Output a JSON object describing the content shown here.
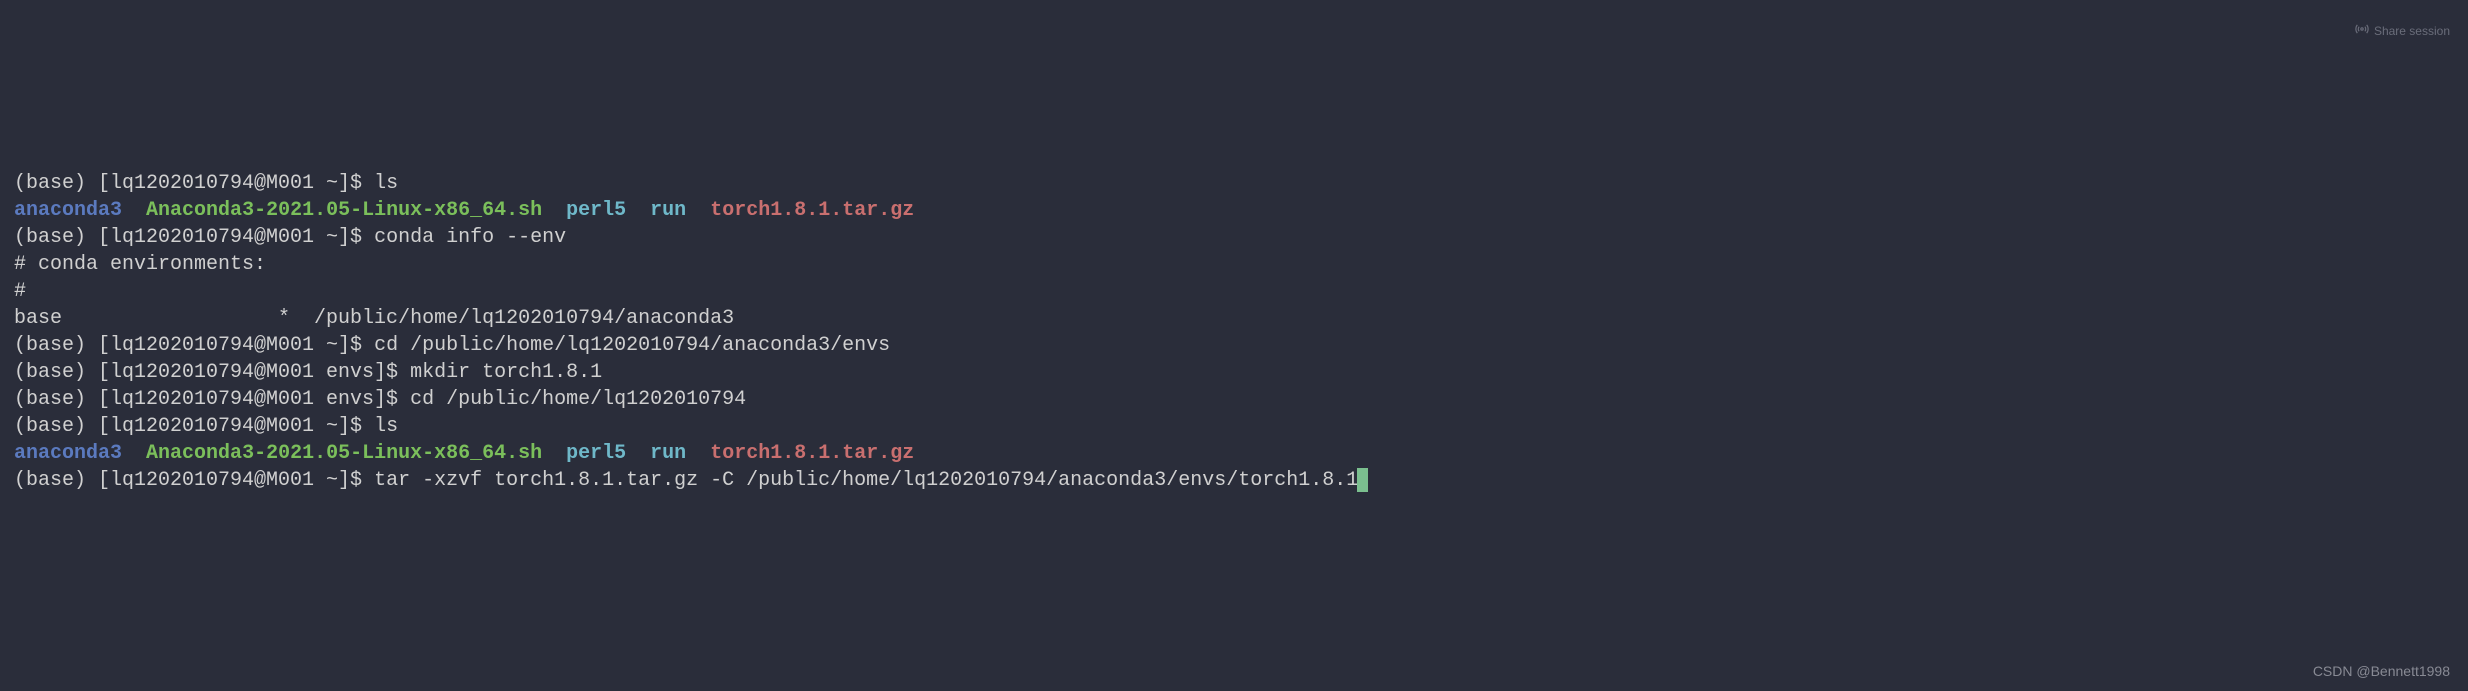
{
  "share": {
    "label": "Share session"
  },
  "watermark": "CSDN @Bennett1998",
  "lines": {
    "l1": {
      "prompt": "(base) [lq1202010794@M001 ~]$ ",
      "cmd": "ls"
    },
    "ls_out1": {
      "anaconda3": "anaconda3",
      "installer": "Anaconda3-2021.05-Linux-x86_64.sh",
      "perl5": "perl5",
      "run": "run",
      "tarball": "torch1.8.1.tar.gz"
    },
    "l3": {
      "prompt": "(base) [lq1202010794@M001 ~]$ ",
      "cmd": "conda info --env"
    },
    "l4": "# conda environments:",
    "l5": "#",
    "l6": "base                  *  /public/home/lq1202010794/anaconda3",
    "l7": "",
    "l8": {
      "prompt": "(base) [lq1202010794@M001 ~]$ ",
      "cmd": "cd /public/home/lq1202010794/anaconda3/envs"
    },
    "l9": {
      "prompt": "(base) [lq1202010794@M001 envs]$ ",
      "cmd": "mkdir torch1.8.1"
    },
    "l10": {
      "prompt": "(base) [lq1202010794@M001 envs]$ ",
      "cmd": "cd /public/home/lq1202010794"
    },
    "l11": {
      "prompt": "(base) [lq1202010794@M001 ~]$ ",
      "cmd": "ls"
    },
    "ls_out2": {
      "anaconda3": "anaconda3",
      "installer": "Anaconda3-2021.05-Linux-x86_64.sh",
      "perl5": "perl5",
      "run": "run",
      "tarball": "torch1.8.1.tar.gz"
    },
    "l13": {
      "prompt": "(base) [lq1202010794@M001 ~]$ ",
      "cmd": "tar -xzvf torch1.8.1.tar.gz -C /public/home/lq1202010794/anaconda3/envs/torch1.8.1"
    }
  }
}
